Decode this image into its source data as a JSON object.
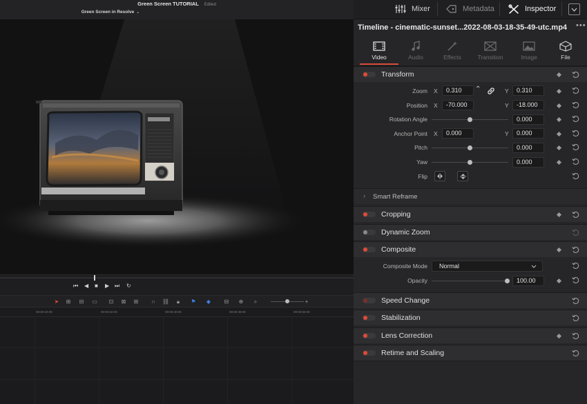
{
  "header": {
    "project_title": "Green Screen TUTORIAL",
    "edited_label": "Edited",
    "timeline_name": "Green Screen in Resolve"
  },
  "right_tabs": {
    "mixer": "Mixer",
    "metadata": "Metadata",
    "inspector": "Inspector"
  },
  "inspector": {
    "clip_title": "Timeline - cinematic-sunset...2022-08-03-18-35-49-utc.mp4",
    "subtabs": [
      {
        "label": "Video",
        "icon": "film-icon"
      },
      {
        "label": "Audio",
        "icon": "music-note-icon"
      },
      {
        "label": "Effects",
        "icon": "wand-icon"
      },
      {
        "label": "Transition",
        "icon": "transition-icon"
      },
      {
        "label": "Image",
        "icon": "image-icon"
      },
      {
        "label": "File",
        "icon": "file-icon"
      }
    ],
    "transform": {
      "title": "Transform",
      "zoom_label": "Zoom",
      "zoom_x": "0.310",
      "zoom_y": "0.310",
      "position_label": "Position",
      "position_x": "-70.000",
      "position_y": "-18.000",
      "rotation_label": "Rotation Angle",
      "rotation_value": "0.000",
      "anchor_label": "Anchor Point",
      "anchor_x": "0.000",
      "anchor_y": "0.000",
      "pitch_label": "Pitch",
      "pitch_value": "0.000",
      "yaw_label": "Yaw",
      "yaw_value": "0.000",
      "flip_label": "Flip",
      "x_label": "X",
      "y_label": "Y"
    },
    "smart_reframe": "Smart Reframe",
    "cropping": "Cropping",
    "dynamic_zoom": "Dynamic Zoom",
    "composite": {
      "title": "Composite",
      "mode_label": "Composite Mode",
      "mode_value": "Normal",
      "opacity_label": "Opacity",
      "opacity_value": "100.00"
    },
    "speed_change": "Speed Change",
    "stabilization": "Stabilization",
    "lens_correction": "Lens Correction",
    "retime_scaling": "Retime and Scaling"
  },
  "timeline": {
    "ticks": [
      "00:00:24:00",
      "00:00:32:00",
      "00:00:40:00",
      "00:00:48:00",
      "00:00:56:00"
    ]
  },
  "colors": {
    "accent": "#e04a35",
    "panel": "#262628",
    "header": "#2e2e31"
  }
}
